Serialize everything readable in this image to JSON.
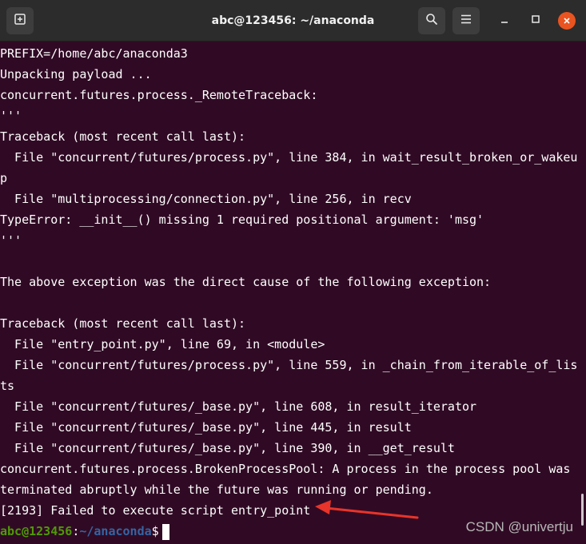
{
  "window": {
    "title": "abc@123456: ~/anaconda",
    "icons": {
      "new_tab": "new-tab-icon",
      "search": "search-icon",
      "menu": "hamburger-menu-icon",
      "minimize": "minimize-icon",
      "maximize": "maximize-icon",
      "close": "close-icon"
    },
    "accent_close": "#e95420"
  },
  "terminal": {
    "background": "#300a24",
    "lines": [
      "PREFIX=/home/abc/anaconda3",
      "Unpacking payload ...",
      "concurrent.futures.process._RemoteTraceback:",
      "'''",
      "Traceback (most recent call last):",
      "  File \"concurrent/futures/process.py\", line 384, in wait_result_broken_or_wakeu",
      "p",
      "  File \"multiprocessing/connection.py\", line 256, in recv",
      "TypeError: __init__() missing 1 required positional argument: 'msg'",
      "'''",
      "",
      "The above exception was the direct cause of the following exception:",
      "",
      "Traceback (most recent call last):",
      "  File \"entry_point.py\", line 69, in <module>",
      "  File \"concurrent/futures/process.py\", line 559, in _chain_from_iterable_of_lis",
      "ts",
      "  File \"concurrent/futures/_base.py\", line 608, in result_iterator",
      "  File \"concurrent/futures/_base.py\", line 445, in result",
      "  File \"concurrent/futures/_base.py\", line 390, in __get_result",
      "concurrent.futures.process.BrokenProcessPool: A process in the process pool was",
      "terminated abruptly while the future was running or pending.",
      "[2193] Failed to execute script entry_point"
    ],
    "prompt": {
      "user_host": "abc@123456",
      "separator": ":",
      "path": "~/anaconda",
      "symbol": "$"
    }
  },
  "annotation": {
    "arrow_color": "#e8342a"
  },
  "watermark": "CSDN @univertju"
}
